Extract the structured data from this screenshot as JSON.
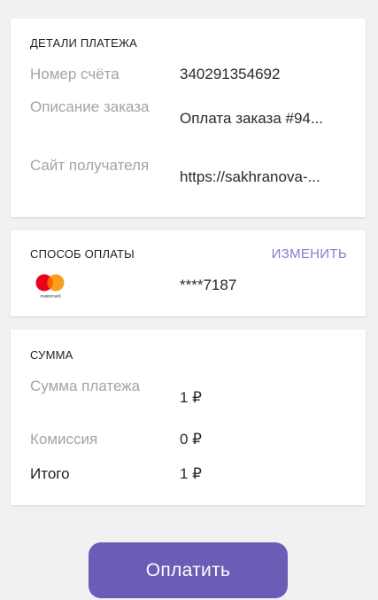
{
  "details": {
    "title": "ДЕТАЛИ ПЛАТЕЖА",
    "account_label": "Номер счёта",
    "account_value": "340291354692",
    "description_label": "Описание заказа",
    "description_value": "Оплата заказа #94...",
    "site_label": "Сайт получателя",
    "site_value": "https://sakhranova-..."
  },
  "payment": {
    "title": "СПОСОБ ОПЛАТЫ",
    "change_label": "ИЗМЕНИТЬ",
    "card_masked": "****7187",
    "card_brand_icon": "mastercard-icon",
    "card_brand_text": "mastercard",
    "colors": {
      "mc_red": "#eb001b",
      "mc_orange": "#f79e1b",
      "mc_overlap": "#ff5f00"
    }
  },
  "sum": {
    "title": "СУММА",
    "amount_label": "Сумма платежа",
    "amount_value": "1 ₽",
    "fee_label": "Комиссия",
    "fee_value": "0 ₽",
    "total_label": "Итого",
    "total_value": "1 ₽"
  },
  "actions": {
    "pay_label": "Оплатить"
  },
  "colors": {
    "accent": "#6c5cb6",
    "link": "#8c7ad0",
    "muted_text": "#a4a4a8",
    "background": "#f1f1f4"
  }
}
